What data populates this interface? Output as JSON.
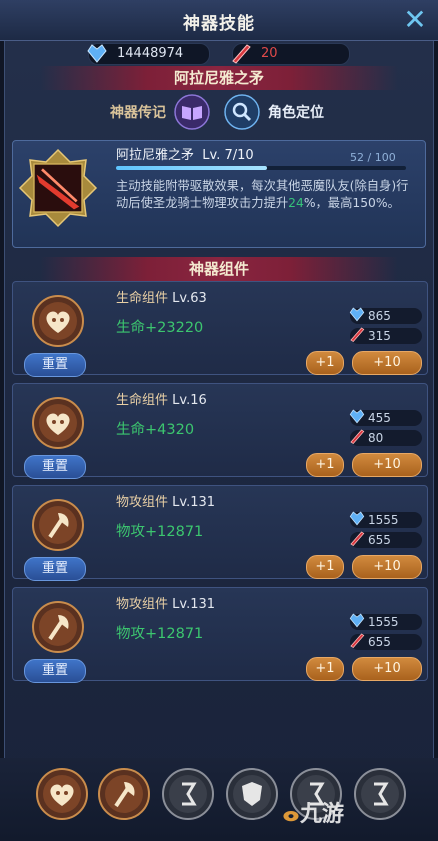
{
  "header": {
    "title": "神器技能",
    "close_icon": "close-icon"
  },
  "currencies": [
    {
      "icon": "blue-crystal-icon",
      "value": "14448974"
    },
    {
      "icon": "red-blade-icon",
      "value": "20",
      "color": "#e04a4a"
    }
  ],
  "artifact_banner": "阿拉尼雅之矛",
  "tabs": [
    {
      "label": "神器传记",
      "icon": "book-icon"
    },
    {
      "label": "角色定位",
      "icon": "magnifier-icon"
    }
  ],
  "artifact": {
    "name": "阿拉尼雅之矛",
    "level": "Lv. 7/10",
    "progress_text": "52 / 100",
    "progress": 0.52,
    "desc_before": "主动技能附带驱散效果，每次其他恶魔队友(除自身)行动后使圣龙骑士物理攻击力提升",
    "desc_highlight": "24",
    "desc_after": "%，最高150%。"
  },
  "section_title": "神器组件",
  "components": [
    {
      "name": "生命组件",
      "level": "Lv.63",
      "stat": "生命+23220",
      "icon": "heart-icon",
      "cost_crystal": "865",
      "cost_blade": "315",
      "reset": "重置",
      "plus1": "+1",
      "plus10": "+10"
    },
    {
      "name": "生命组件",
      "level": "Lv.16",
      "stat": "生命+4320",
      "icon": "heart-icon",
      "cost_crystal": "455",
      "cost_blade": "80",
      "reset": "重置",
      "plus1": "+1",
      "plus10": "+10"
    },
    {
      "name": "物攻组件",
      "level": "Lv.131",
      "stat": "物攻+12871",
      "icon": "axe-icon",
      "cost_crystal": "1555",
      "cost_blade": "655",
      "reset": "重置",
      "plus1": "+1",
      "plus10": "+10"
    },
    {
      "name": "物攻组件",
      "level": "Lv.131",
      "stat": "物攻+12871",
      "icon": "axe-icon",
      "cost_crystal": "1555",
      "cost_blade": "655",
      "reset": "重置",
      "plus1": "+1",
      "plus10": "+10"
    }
  ],
  "bottom_slots": [
    "heart-icon",
    "axe-icon",
    "rune-icon",
    "shield-icon",
    "rune-icon",
    "rune-icon"
  ],
  "watermark": "九游",
  "colors": {
    "accent_blue": "#6fc6f0",
    "stat_green": "#3cc66f",
    "button_orange": "#c97b30",
    "banner_red": "#7d2038"
  }
}
